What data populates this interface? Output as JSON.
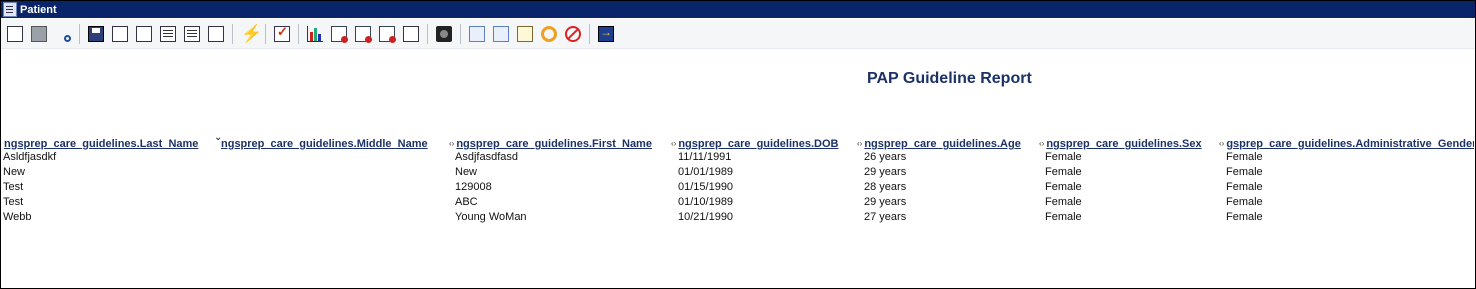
{
  "window": {
    "title": "Patient"
  },
  "toolbar": {
    "groups": [
      [
        "copy-icon",
        "print-icon",
        "print-preview-icon"
      ],
      [
        "save-icon",
        "export-icon",
        "tree-icon",
        "list-icon",
        "field-icon",
        "brush-icon"
      ],
      [
        "lightning-icon"
      ],
      [
        "checklist-icon"
      ],
      [
        "bar-chart-icon",
        "report-icon",
        "report-edit-icon",
        "report-run-icon",
        "download-icon"
      ],
      [
        "camera-icon"
      ],
      [
        "document-icon",
        "folder-icon",
        "note-icon",
        "recycle-icon",
        "cancel-icon"
      ],
      [
        "exit-icon"
      ]
    ]
  },
  "report": {
    "title": "PAP Guideline Report",
    "columns": [
      {
        "label": "ngsprep_care_guidelines.Last_Name",
        "sort_icon": ""
      },
      {
        "label": "ngsprep_care_guidelines.Middle_Name",
        "sort_icon": ""
      },
      {
        "label": "ngsprep_care_guidelines.First_Name",
        "sort_icon": "‹›"
      },
      {
        "label": "ngsprep_care_guidelines.DOB",
        "sort_icon": "‹›"
      },
      {
        "label": "ngsprep_care_guidelines.Age",
        "sort_icon": "‹›"
      },
      {
        "label": "ngsprep_care_guidelines.Sex",
        "sort_icon": "‹›"
      },
      {
        "label": "gsprep_care_guidelines.Administrative_Gender",
        "sort_icon": "‹›"
      }
    ],
    "rows": [
      [
        "Asldfjasdkf",
        "",
        "Asdjfasdfasd",
        "11/11/1991",
        "26 years",
        "Female",
        "Female"
      ],
      [
        "New",
        "",
        "New",
        "01/01/1989",
        "29 years",
        "Female",
        "Female"
      ],
      [
        "Test",
        "",
        "129008",
        "01/15/1990",
        "28 years",
        "Female",
        "Female"
      ],
      [
        "Test",
        "",
        "ABC",
        "01/10/1989",
        "29 years",
        "Female",
        "Female"
      ],
      [
        "Webb",
        "",
        "Young WoMan",
        "10/21/1990",
        "27 years",
        "Female",
        "Female"
      ]
    ]
  }
}
